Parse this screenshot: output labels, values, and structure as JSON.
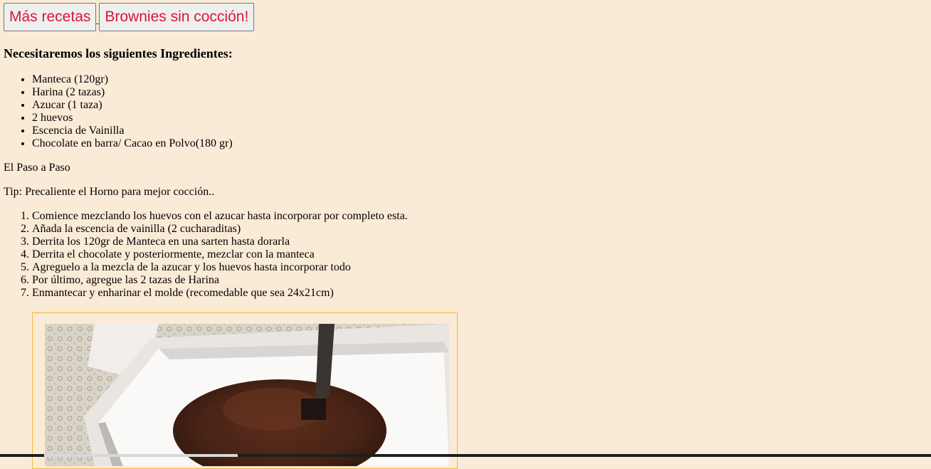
{
  "nav": {
    "more_recipes_label": "Más recetas",
    "recipe_title_label": "Brownies sin cocción!"
  },
  "ingredients": {
    "heading": "Necesitaremos los siguientes Ingredientes:",
    "items": [
      "Manteca (120gr)",
      "Harina (2 tazas)",
      "Azucar (1 taza)",
      "2 huevos",
      "Escencia de Vainilla",
      "Chocolate en barra/ Cacao en Polvo(180 gr)"
    ]
  },
  "steps_section": {
    "title": "El Paso a Paso",
    "tip": "Tip: Precaliente el Horno para mejor cocción..",
    "items": [
      "Comience mezclando los huevos con el azucar hasta incorporar por completo esta.",
      "Añada la escencia de vainilla (2 cucharaditas)",
      "Derrita los 120gr de Manteca en una sarten hasta dorarla",
      "Derrita el chocolate y posteriormente, mezclar con la manteca",
      "Agreguelo a la mezcla de la azucar y los huevos hasta incorporar todo",
      "Por último, agregue las 2 tazas de Harina",
      "Enmantecar y enharinar el molde (recomedable que sea 24x21cm)"
    ]
  },
  "colors": {
    "page_background": "#faebd7",
    "button_text": "#dc143c",
    "photo_border": "#f0b73a"
  }
}
